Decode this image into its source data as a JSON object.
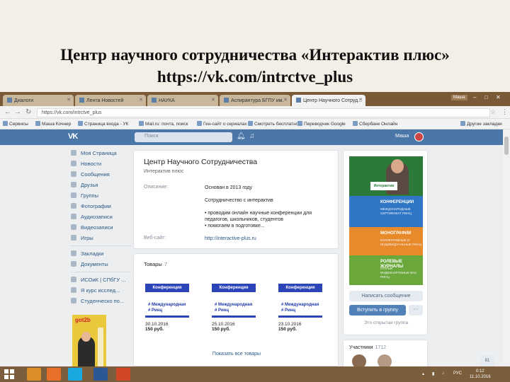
{
  "slide": {
    "title_line1": "Центр научного сотрудничества «Интерактив плюс»",
    "title_line2": "https://vk.com/intrctve_plus"
  },
  "browser": {
    "tabs": [
      "Диалоги",
      "Лента Новостей",
      "НАУКА",
      "Аспирантура БГПУ им.",
      "Центр Научного Сотруд..."
    ],
    "active_tab": 4,
    "window_user": "Маша",
    "url": "https://vk.com/intrctve_plus",
    "bookmarks": [
      "Сервисы",
      "Маша Кочнер",
      "Страница входа - УК",
      "Mail.ru: почта, поиск",
      "Ген-сайт о сериалах",
      "Смотреть бесплатно",
      "Переводчик Google",
      "Сбербанк Онлайн",
      "Другие закладки"
    ]
  },
  "vk": {
    "search_placeholder": "Поиск",
    "user_name": "Маша",
    "left_menu": [
      "Моя Страница",
      "Новости",
      "Сообщения",
      "Друзья",
      "Группы",
      "Фотографии",
      "Аудиозаписи",
      "Видеозаписи",
      "Игры",
      "Закладки",
      "Документы",
      "ИСОиК | СПбГУ ...",
      "Я курс исслед...",
      "Студенческо по..."
    ],
    "ad_brand": "got2b",
    "group": {
      "name": "Центр Научного Сотрудничества",
      "status": "Интерактив плюс",
      "info": [
        {
          "label": "Описание:",
          "lines": [
            "Основан в 2013 году"
          ]
        },
        {
          "label": "",
          "lines": [
            "Сотрудничество с интерактив"
          ]
        },
        {
          "label": "",
          "lines": [
            "• проводим онлайн научные конференции для",
            "педагогов, школьников, студентов",
            "• помогаем в подготовке..."
          ]
        },
        {
          "label": "Веб-сайт:",
          "lines": [
            "http://interactive-plus.ru"
          ],
          "link": true
        }
      ]
    },
    "goods": {
      "title": "Товары",
      "count": "7",
      "items": [
        {
          "banner": "Конференция",
          "tags": [
            "# Международная",
            "# Ринц"
          ],
          "date": "30.10.2016",
          "price": "150 руб."
        },
        {
          "banner": "Конференция",
          "tags": [
            "# Международная",
            "# Ринц"
          ],
          "date": "25.10.2016",
          "price": "150 руб."
        },
        {
          "banner": "Конференция",
          "tags": [
            "# Международная",
            "# Ринц"
          ],
          "date": "23.10.2016",
          "price": "150 руб."
        }
      ],
      "show_all": "Показать все товары"
    },
    "poster": {
      "logo": "Интерактив плюс",
      "blocks": [
        {
          "title": "КОНФЕРЕНЦИИ",
          "sub": "МЕЖДУНАРОДНЫЕ СЕРТИФИКАТ РИНЦ"
        },
        {
          "title": "МОНОГРАФИИ",
          "sub": "КОЛЛЕКТИВНЫЕ И ИНДИВИДУАЛЬНЫЕ РИНЦ"
        },
        {
          "title": "РОЛЕВЫЕ ЖУРНАЛЫ",
          "sub": "СТАТЬИ ИНДЕКСИРУЕМЫЕ ВАК РИНЦ"
        }
      ]
    },
    "buttons": {
      "message": "Написать сообщение",
      "join": "Вступить в группу",
      "more": "···"
    },
    "closed_group": "Это открытая группа",
    "members": {
      "title": "Участники",
      "count": "1712"
    },
    "friends_tab": "81"
  },
  "taskbar": {
    "lang": "РУС",
    "time": "0:12",
    "date": "11.10.2016"
  }
}
